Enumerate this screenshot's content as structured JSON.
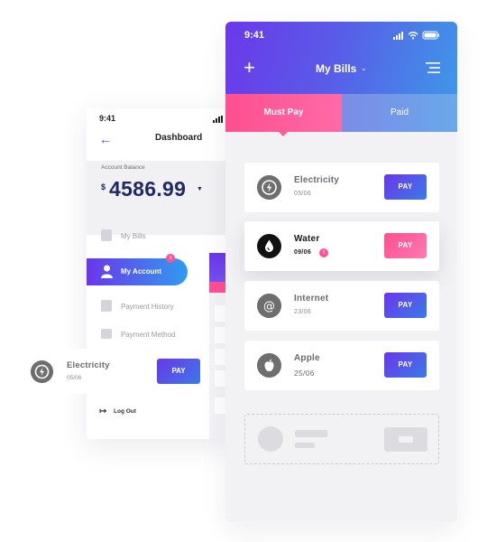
{
  "colors": {
    "primary_purple": "#6a36ea",
    "primary_blue": "#3f96e8",
    "accent_pink": "#ff4f8f",
    "balance_navy": "#1f2a63"
  },
  "dashboard": {
    "time": "9:41",
    "back_icon": "arrow-left-icon",
    "title": "Dashboard",
    "balance_label": "Account Balance",
    "currency": "$",
    "balance": "4586.99",
    "menu": {
      "my_bills": "My Bills",
      "my_account": "My Account",
      "my_account_badge": "3",
      "payment_history": "Payment History",
      "payment_method": "Payment Method"
    },
    "logout": "Log Out"
  },
  "floating_card": {
    "name": "Electricity",
    "date": "05/06",
    "button": "PAY"
  },
  "my_bills": {
    "time": "9:41",
    "title": "My Bills",
    "tabs": {
      "must_pay": "Must Pay",
      "paid": "Paid"
    },
    "bills": [
      {
        "name": "Electricity",
        "date": "05/06",
        "button": "PAY",
        "icon": "electricity-icon"
      },
      {
        "name": "Water",
        "date": "09/06",
        "button": "PAY",
        "icon": "water-drop-icon",
        "badge": "!"
      },
      {
        "name": "Internet",
        "date": "23/06",
        "button": "PAY",
        "icon": "at-sign-icon"
      },
      {
        "name": "Apple",
        "date": "25/06",
        "button": "PAY",
        "icon": "apple-icon"
      }
    ]
  }
}
